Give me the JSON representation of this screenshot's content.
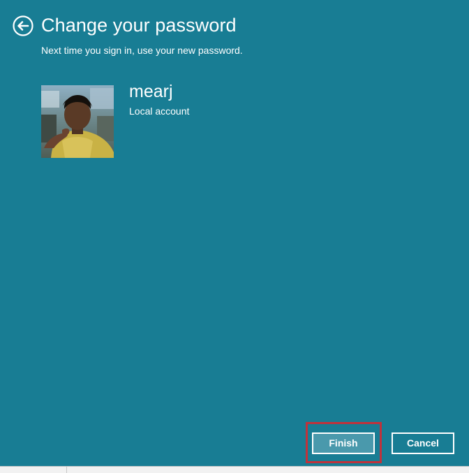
{
  "page": {
    "title": "Change your password",
    "subtitle": "Next time you sign in, use your new password."
  },
  "account": {
    "name": "mearj",
    "type": "Local account"
  },
  "buttons": {
    "finish_label": "Finish",
    "cancel_label": "Cancel"
  },
  "icons": {
    "back": "back-arrow-circle-icon"
  },
  "colors": {
    "background": "#187d94",
    "finish_button_fill": "#4a99ac",
    "highlight": "#c0323b",
    "text": "#ffffff"
  }
}
